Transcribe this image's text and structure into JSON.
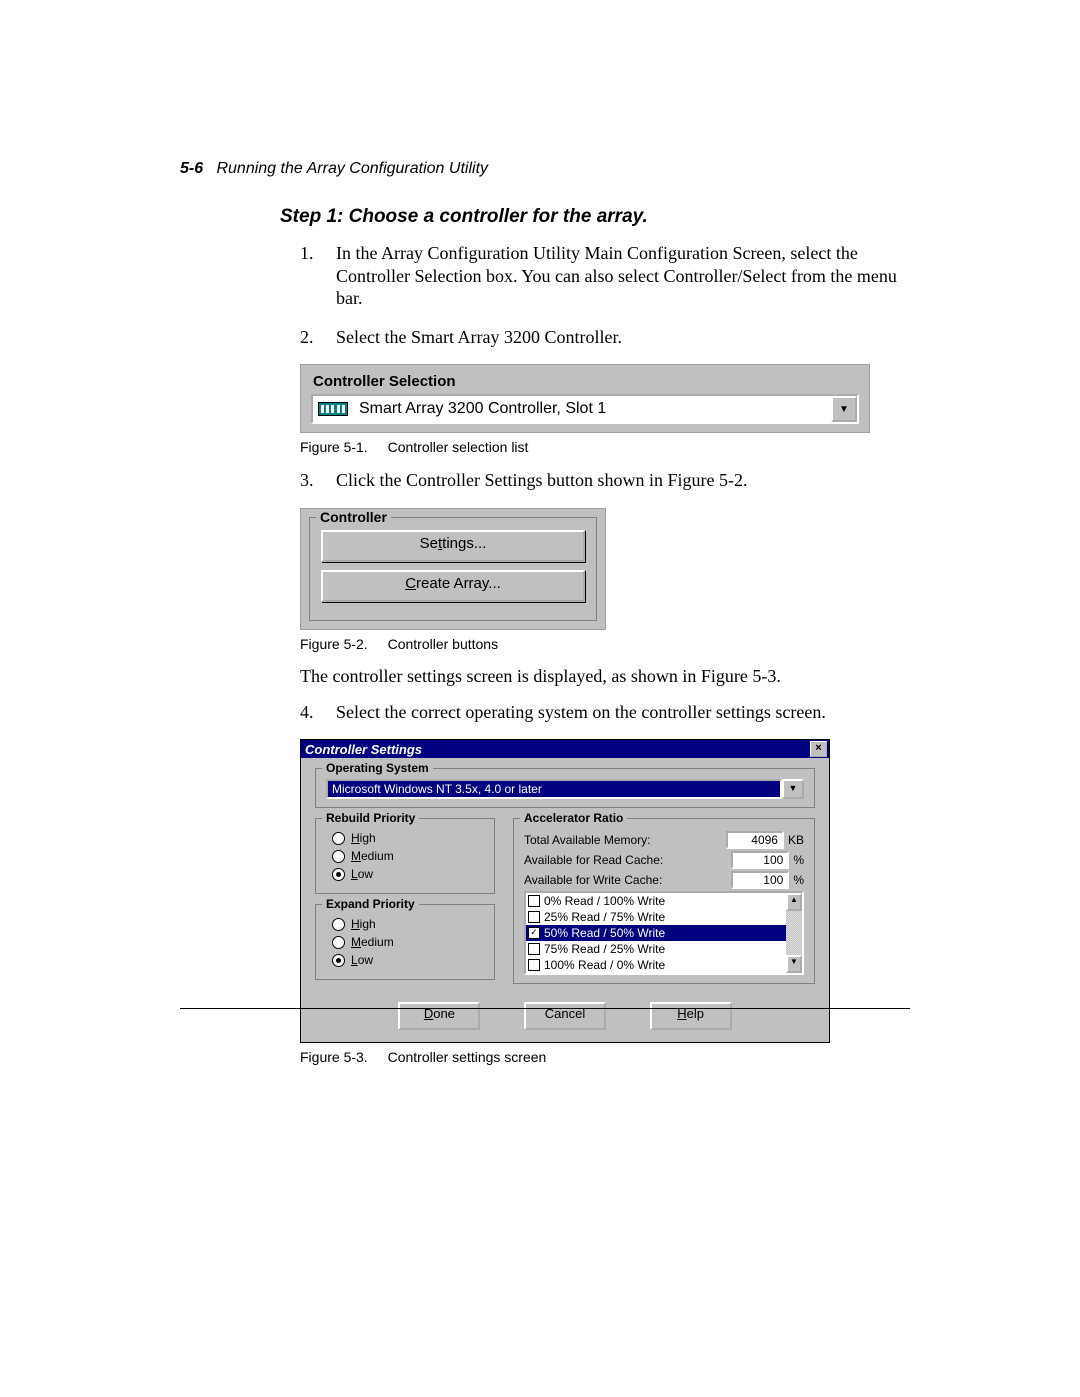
{
  "header": {
    "pagenum": "5-6",
    "title": "Running the Array Configuration Utility"
  },
  "step_title": "Step 1: Choose a controller for the array.",
  "items": {
    "i1_num": "1.",
    "i1_text": "In the Array Configuration Utility Main Configuration Screen, select the Controller Selection box. You can also select Controller/Select from the menu bar.",
    "i2_num": "2.",
    "i2_text": "Select the Smart Array 3200 Controller.",
    "i3_num": "3.",
    "i3_text": "Click the Controller Settings button shown in Figure 5-2.",
    "i4_num": "4.",
    "i4_text": "Select the correct operating system on the controller settings screen."
  },
  "para_mid": "The controller settings screen is displayed, as shown in Figure 5-3.",
  "fig1": {
    "title": "Controller Selection",
    "value": "Smart Array 3200 Controller, Slot 1",
    "cap_num": "Figure 5-1.",
    "cap_text": "Controller selection list"
  },
  "fig2": {
    "legend": "Controller",
    "btn1_pre": "Se",
    "btn1_ul": "t",
    "btn1_post": "tings...",
    "btn2_ul": "C",
    "btn2_post": "reate Array...",
    "cap_num": "Figure 5-2.",
    "cap_text": "Controller buttons"
  },
  "fig3": {
    "title": "Controller Settings",
    "os_legend": "Operating System",
    "os_value": "Microsoft Windows NT 3.5x, 4.0 or later",
    "rebuild_legend": "Rebuild Priority",
    "expand_legend": "Expand Priority",
    "radio_high_ul": "H",
    "radio_high_post": "igh",
    "radio_med_ul": "M",
    "radio_med_post": "edium",
    "radio_low_ul": "L",
    "radio_low_post": "ow",
    "accel_legend": "Accelerator Ratio",
    "mem_label": "Total Available Memory:",
    "mem_val": "4096",
    "mem_unit": "KB",
    "read_label": "Available for Read Cache:",
    "read_val": "100",
    "read_unit": "%",
    "write_label": "Available for Write Cache:",
    "write_val": "100",
    "write_unit": "%",
    "ratios": {
      "r0": "0% Read / 100% Write",
      "r1": "25% Read / 75% Write",
      "r2": "50% Read / 50% Write",
      "r3": "75% Read / 25% Write",
      "r4": "100% Read / 0% Write"
    },
    "done_ul": "D",
    "done_post": "one",
    "cancel": "Cancel",
    "help_ul": "H",
    "help_post": "elp",
    "cap_num": "Figure 5-3.",
    "cap_text": "Controller settings screen"
  }
}
